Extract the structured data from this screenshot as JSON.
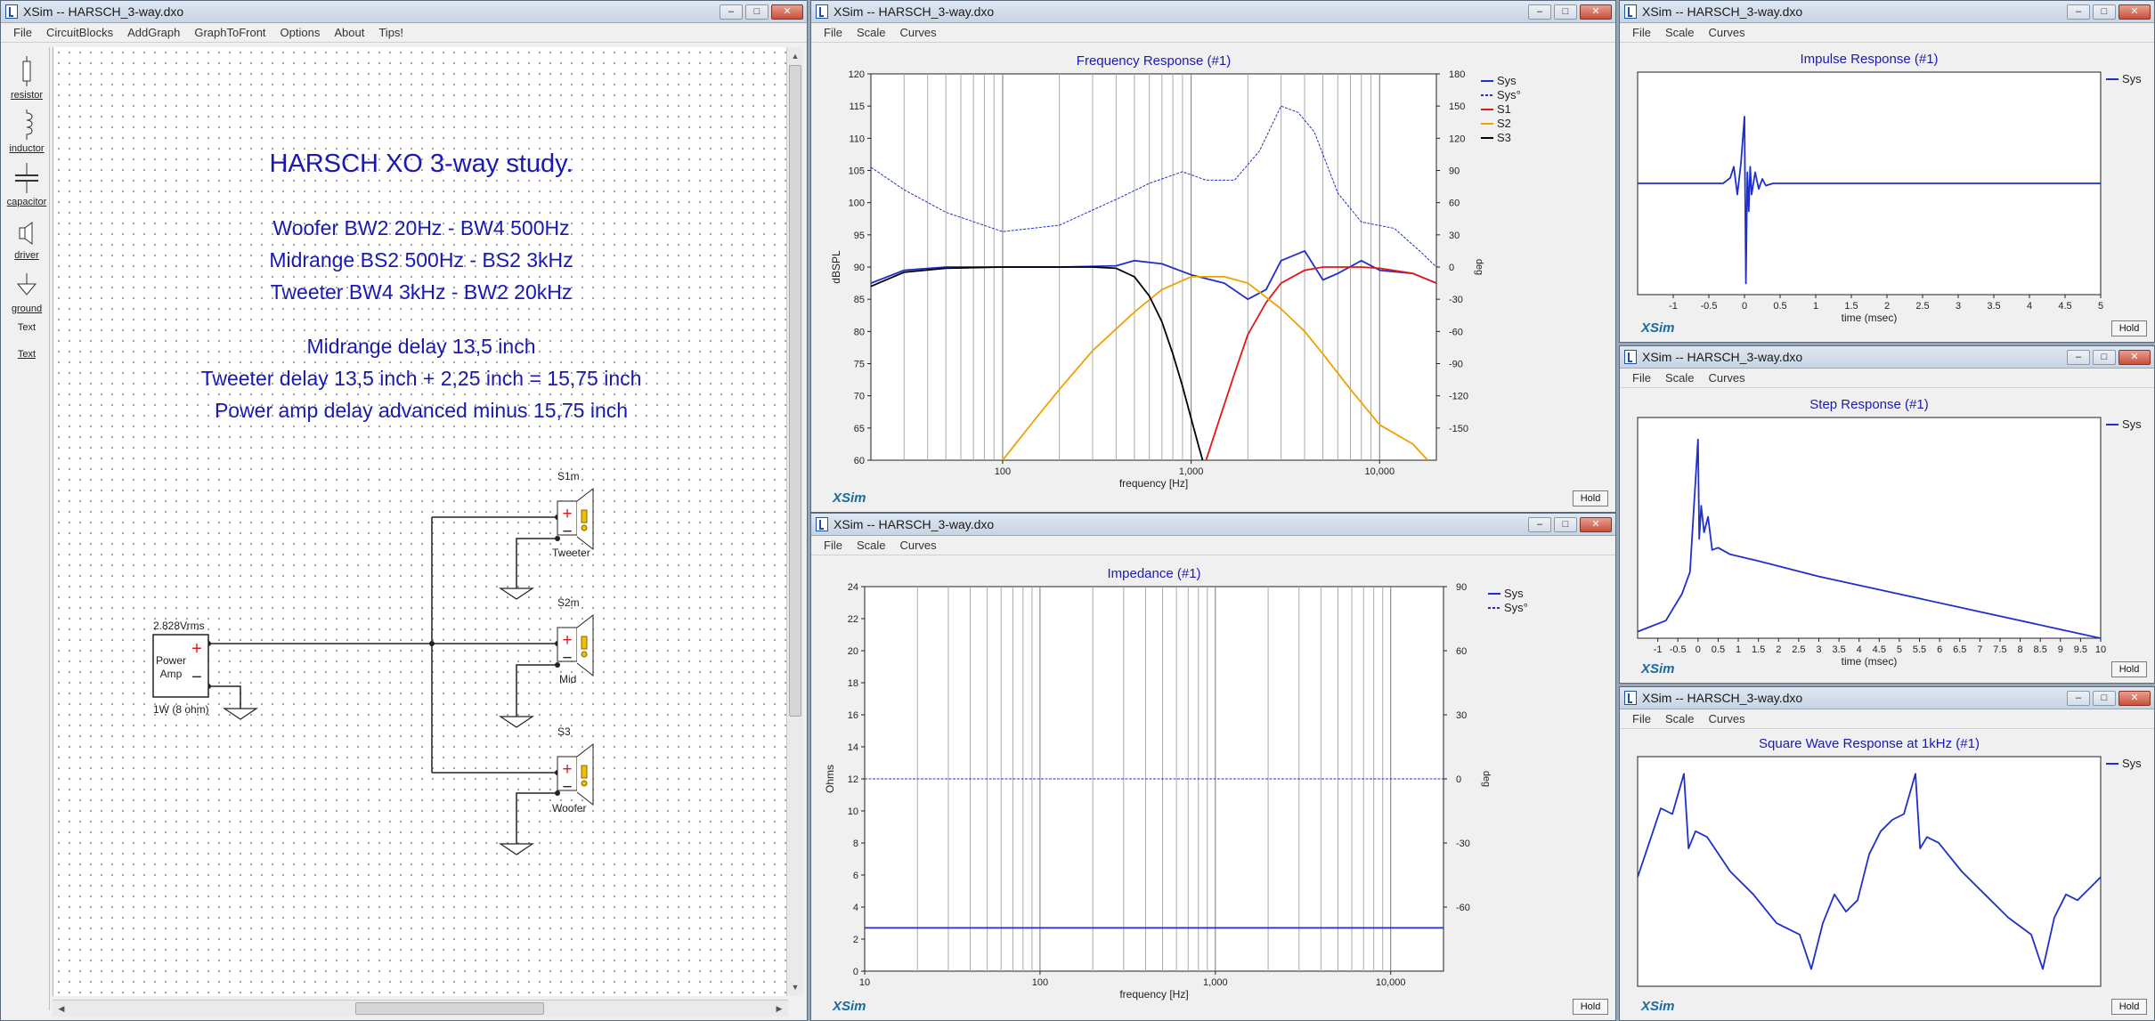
{
  "windows": {
    "main": {
      "title": "XSim -- HARSCH_3-way.dxo",
      "menu": [
        "File",
        "CircuitBlocks",
        "AddGraph",
        "GraphToFront",
        "Options",
        "About",
        "Tips!"
      ]
    },
    "freq": {
      "title": "XSim -- HARSCH_3-way.dxo",
      "menu": [
        "File",
        "Scale",
        "Curves"
      ]
    },
    "imp": {
      "title": "XSim -- HARSCH_3-way.dxo",
      "menu": [
        "File",
        "Scale",
        "Curves"
      ]
    },
    "impulse": {
      "title": "XSim -- HARSCH_3-way.dxo",
      "menu": [
        "File",
        "Scale",
        "Curves"
      ]
    },
    "step": {
      "title": "XSim -- HARSCH_3-way.dxo",
      "menu": [
        "File",
        "Scale",
        "Curves"
      ]
    },
    "square": {
      "title": "XSim -- HARSCH_3-way.dxo",
      "menu": [
        "File",
        "Scale",
        "Curves"
      ]
    }
  },
  "window_buttons": {
    "min": "–",
    "max": "□",
    "close": "✕"
  },
  "toolbox": [
    "resistor",
    "inductor",
    "capacitor",
    "driver",
    "ground",
    "Text",
    "Text"
  ],
  "notes": {
    "title": "HARSCH XO 3-way study.",
    "lines1": [
      "Woofer BW2 20Hz - BW4 500Hz",
      "Midrange BS2 500Hz - BS2 3kHz",
      "Tweeter BW4 3kHz - BW2 20kHz"
    ],
    "lines2": [
      "Midrange delay 13,5 inch",
      "Tweeter delay 13,5 inch + 2,25 inch = 15,75 inch",
      "Power amp delay advanced minus 15,75 inch"
    ]
  },
  "schematic": {
    "amp_voltage": "2.828Vrms",
    "amp_label": [
      "Power",
      "Amp"
    ],
    "amp_power": "1W (8 ohm)",
    "plus": "+",
    "minus": "−",
    "drivers": [
      {
        "ref": "S1m",
        "name": "Tweeter"
      },
      {
        "ref": "S2m",
        "name": "Mid"
      },
      {
        "ref": "S3",
        "name": "Woofer"
      }
    ]
  },
  "brand": "XSim",
  "hold_label": "Hold",
  "colors": {
    "sys": "#1f2fcc",
    "s1": "#e01818",
    "s2": "#f0a000",
    "s3": "#000000",
    "title": "#1a1ab0",
    "brand": "#1a6aa0"
  },
  "chart_data": [
    {
      "type": "line",
      "title": "Frequency Response (#1)",
      "xlabel": "frequency [Hz]",
      "ylabel": "dBSPL",
      "y2label": "deg",
      "xscale": "log",
      "xlim": [
        20,
        20000
      ],
      "ylim": [
        60,
        120
      ],
      "y2lim": [
        -180,
        180
      ],
      "xticks": [
        100,
        1000,
        10000
      ],
      "xtick_labels": [
        "100",
        "1,000",
        "10,000"
      ],
      "yticks": [
        60,
        65,
        70,
        75,
        80,
        85,
        90,
        95,
        100,
        105,
        110,
        115,
        120
      ],
      "y2ticks": [
        -150,
        -120,
        -90,
        -60,
        -30,
        0,
        30,
        60,
        90,
        120,
        150,
        180
      ],
      "legend": [
        "Sys",
        "Sys°",
        "S1",
        "S2",
        "S3"
      ],
      "legend_placement": "top-right",
      "series": [
        {
          "name": "Sys",
          "x": [
            20,
            30,
            50,
            100,
            200,
            400,
            500,
            700,
            1000,
            1500,
            2000,
            2500,
            3000,
            4000,
            5000,
            6000,
            8000,
            10000,
            15000,
            20000
          ],
          "y": [
            87.5,
            89.5,
            90,
            90,
            90,
            90.2,
            91,
            90.5,
            88.8,
            87.5,
            85,
            86.5,
            91,
            92.5,
            88,
            89,
            91,
            89.5,
            89,
            87.5
          ]
        },
        {
          "name": "Sys°",
          "x": [
            20,
            30,
            50,
            100,
            200,
            400,
            600,
            900,
            1200,
            1700,
            2300,
            3000,
            3700,
            4500,
            6000,
            8000,
            12000,
            17000,
            20000
          ],
          "y": [
            105.5,
            102,
            98.5,
            95.5,
            96.5,
            100.5,
            103,
            104.8,
            103.5,
            103.5,
            108,
            115,
            114,
            111,
            101.5,
            97,
            96,
            92,
            90
          ]
        },
        {
          "name": "S1",
          "x": [
            1200,
            1400,
            1700,
            2000,
            2500,
            3000,
            4000,
            5000,
            6000,
            8000,
            10000,
            15000,
            20000
          ],
          "y": [
            60,
            66,
            73.5,
            79.5,
            84.5,
            87.5,
            89.5,
            90,
            90,
            90,
            89.8,
            89,
            87.5
          ]
        },
        {
          "name": "S2",
          "x": [
            100,
            150,
            200,
            300,
            500,
            700,
            1000,
            1500,
            2000,
            3000,
            4000,
            5000,
            7000,
            10000,
            15000,
            18000
          ],
          "y": [
            60,
            66.5,
            71,
            77,
            83,
            86.5,
            88.5,
            88.5,
            87.5,
            83.5,
            80,
            76.5,
            71,
            65.5,
            62.5,
            60
          ]
        },
        {
          "name": "S3",
          "x": [
            20,
            30,
            50,
            100,
            200,
            300,
            400,
            500,
            600,
            700,
            800,
            900,
            1000,
            1100,
            1150
          ],
          "y": [
            87,
            89.2,
            89.8,
            90,
            90,
            90,
            89.8,
            88.5,
            85.5,
            81.5,
            76.5,
            71.5,
            66.5,
            62,
            60
          ]
        }
      ]
    },
    {
      "type": "line",
      "title": "Impedance (#1)",
      "xlabel": "frequency [Hz]",
      "ylabel": "Ohms",
      "y2label": "deg",
      "xscale": "log",
      "xlim": [
        10,
        20000
      ],
      "ylim": [
        0,
        24
      ],
      "y2lim": [
        -90,
        90
      ],
      "xticks": [
        10,
        100,
        1000,
        10000
      ],
      "xtick_labels": [
        "10",
        "100",
        "1,000",
        "10,000"
      ],
      "yticks": [
        0,
        2,
        4,
        6,
        8,
        10,
        12,
        14,
        16,
        18,
        20,
        22,
        24
      ],
      "y2ticks": [
        -60,
        -30,
        0,
        30,
        60,
        90
      ],
      "legend": [
        "Sys",
        "Sys°"
      ],
      "legend_placement": "top-right",
      "series": [
        {
          "name": "Sys",
          "x": [
            10,
            20000
          ],
          "y": [
            2.7,
            2.7
          ]
        },
        {
          "name": "Sys°",
          "x": [
            10,
            20000
          ],
          "y": [
            12,
            12
          ]
        }
      ]
    },
    {
      "type": "line",
      "title": "Impulse Response (#1)",
      "xlabel": "time (msec)",
      "xlim": [
        -1.5,
        5
      ],
      "xticks": [
        -1,
        -0.5,
        0,
        0.5,
        1,
        1.5,
        2,
        2.5,
        3,
        3.5,
        4,
        4.5,
        5
      ],
      "xtick_labels": [
        "-1",
        "-0.5",
        "0",
        "0.5",
        "1",
        "1.5",
        "2",
        "2.5",
        "3",
        "3.5",
        "4",
        "4.5",
        "5"
      ],
      "ylim": [
        -1,
        1
      ],
      "legend": [
        "Sys"
      ],
      "legend_placement": "top-right",
      "series": [
        {
          "name": "Sys",
          "x": [
            -1.5,
            -0.3,
            -0.2,
            -0.15,
            -0.1,
            -0.05,
            0,
            0.02,
            0.04,
            0.06,
            0.08,
            0.1,
            0.15,
            0.2,
            0.25,
            0.3,
            0.4,
            5
          ],
          "y": [
            0,
            0,
            0.05,
            0.15,
            -0.1,
            0.18,
            0.6,
            -0.9,
            0.1,
            -0.25,
            0.15,
            -0.1,
            0.1,
            -0.05,
            0.04,
            -0.02,
            0,
            0
          ]
        }
      ]
    },
    {
      "type": "line",
      "title": "Step Response (#1)",
      "xlabel": "time (msec)",
      "xlim": [
        -1.5,
        10
      ],
      "xticks": [
        -1,
        -0.5,
        0,
        0.5,
        1,
        1.5,
        2,
        2.5,
        3,
        3.5,
        4,
        4.5,
        5,
        5.5,
        6,
        6.5,
        7,
        7.5,
        8,
        8.5,
        9,
        9.5,
        10
      ],
      "xtick_labels": [
        "-1",
        "-0.5",
        "0",
        "0.5",
        "1",
        "1.5",
        "2",
        "2.5",
        "3",
        "3.5",
        "4",
        "4.5",
        "5",
        "5.5",
        "6",
        "6.5",
        "7",
        "7.5",
        "8",
        "8.5",
        "9",
        "9.5",
        "10"
      ],
      "ylim": [
        0,
        1
      ],
      "legend": [
        "Sys"
      ],
      "legend_placement": "top-right",
      "series": [
        {
          "name": "Sys",
          "x": [
            -1.5,
            -0.8,
            -0.4,
            -0.2,
            0,
            0.03,
            0.08,
            0.15,
            0.25,
            0.35,
            0.5,
            0.8,
            1.5,
            3,
            5,
            7,
            9,
            10
          ],
          "y": [
            0.03,
            0.08,
            0.2,
            0.3,
            0.9,
            0.45,
            0.6,
            0.48,
            0.55,
            0.4,
            0.41,
            0.38,
            0.35,
            0.28,
            0.2,
            0.12,
            0.04,
            0.0
          ]
        }
      ]
    },
    {
      "type": "line",
      "title": "Square Wave Response at 1kHz (#1)",
      "xlim": [
        0,
        2
      ],
      "ylim": [
        -1,
        1
      ],
      "legend": [
        "Sys"
      ],
      "legend_placement": "top-right",
      "series": [
        {
          "name": "Sys",
          "x": [
            0,
            0.05,
            0.1,
            0.15,
            0.2,
            0.22,
            0.25,
            0.3,
            0.4,
            0.5,
            0.6,
            0.7,
            0.75,
            0.8,
            0.85,
            0.9,
            0.95,
            1.0,
            1.05,
            1.1,
            1.15,
            1.2,
            1.22,
            1.25,
            1.3,
            1.4,
            1.5,
            1.6,
            1.7,
            1.75,
            1.8,
            1.85,
            1.9,
            1.95,
            2.0
          ],
          "y": [
            -0.05,
            0.25,
            0.55,
            0.5,
            0.85,
            0.2,
            0.35,
            0.3,
            0.0,
            -0.2,
            -0.45,
            -0.55,
            -0.85,
            -0.45,
            -0.2,
            -0.35,
            -0.25,
            0.15,
            0.35,
            0.45,
            0.5,
            0.85,
            0.2,
            0.3,
            0.25,
            0.0,
            -0.2,
            -0.4,
            -0.55,
            -0.85,
            -0.4,
            -0.2,
            -0.25,
            -0.15,
            -0.05
          ]
        }
      ]
    }
  ]
}
